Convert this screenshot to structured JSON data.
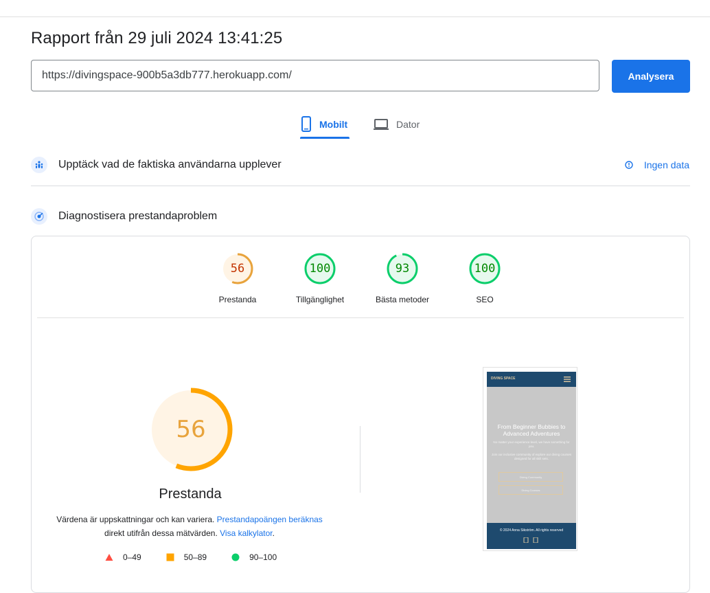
{
  "header": {
    "title": "Rapport från 29 juli 2024 13:41:25"
  },
  "url_input": {
    "value": "https://divingspace-900b5a3db777.herokuapp.com/"
  },
  "analyze_button": {
    "label": "Analysera"
  },
  "tabs": [
    {
      "label": "Mobilt",
      "icon": "phone-icon",
      "active": true
    },
    {
      "label": "Dator",
      "icon": "laptop-icon",
      "active": false
    }
  ],
  "field_data": {
    "label": "Upptäck vad de faktiska användarna upplever",
    "no_data_label": "Ingen data"
  },
  "lab_data": {
    "label": "Diagnostisera prestandaproblem"
  },
  "scores": [
    {
      "value": "56",
      "label": "Prestanda",
      "color": "#e8a33c",
      "fraction": 0.56
    },
    {
      "value": "100",
      "label": "Tillgänglighet",
      "color": "#0cce6b",
      "fraction": 1.0
    },
    {
      "value": "93",
      "label": "Bästa metoder",
      "color": "#0cce6b",
      "fraction": 0.93
    },
    {
      "value": "100",
      "label": "SEO",
      "color": "#0cce6b",
      "fraction": 1.0
    }
  ],
  "performance": {
    "score": "56",
    "fraction": 0.56,
    "title": "Prestanda",
    "note_text_1": "Värdena är uppskattningar och kan variera. ",
    "note_link_1": "Prestandapoängen beräknas",
    "note_text_2": "direkt utifrån dessa mätvärden. ",
    "note_link_2": "Visa kalkylator",
    "note_text_3": "."
  },
  "legend": [
    {
      "range": "0–49",
      "shape": "triangle",
      "color": "#ff4e42"
    },
    {
      "range": "50–89",
      "shape": "square",
      "color": "#ffa400"
    },
    {
      "range": "90–100",
      "shape": "circle",
      "color": "#0cce6b"
    }
  ],
  "screenshot": {
    "logo_text": "DIVING SPACE",
    "headline": "From Beginner Bubbies to Advanced Adventures",
    "sub1": "No matter your experience level, we have something for you.",
    "sub2": "Join our inclusive community of explore our diving courses designed for all skill sets.",
    "btn1": "Diving Community",
    "btn2": "Diving Courses",
    "footer": "© 2024 Anna Sikström. All rights reserved"
  },
  "colors": {
    "accent": "#1a73e8",
    "average": "#ffa400",
    "good": "#0cce6b",
    "poor": "#ff4e42"
  }
}
